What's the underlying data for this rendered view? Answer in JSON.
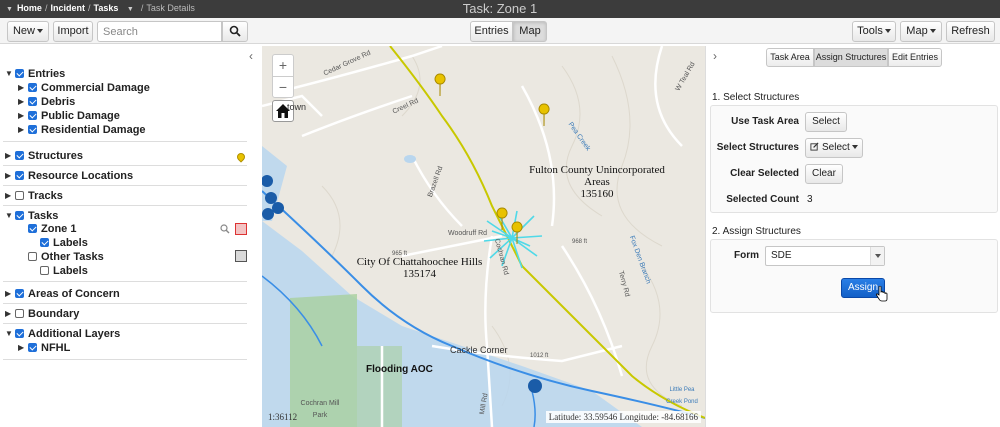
{
  "titlebar": {
    "breadcrumb": [
      "Home",
      "Incident",
      "Tasks"
    ],
    "current": "Task Details",
    "window_title": "Task: Zone 1"
  },
  "toolbar": {
    "new_label": "New",
    "import_label": "Import",
    "search_placeholder": "Search",
    "view_tabs": [
      "Entries",
      "Map"
    ],
    "active_view": "Map",
    "tools_label": "Tools",
    "map_label": "Map",
    "refresh_label": "Refresh"
  },
  "layers": {
    "entries": {
      "label": "Entries",
      "children": [
        "Commercial Damage",
        "Debris",
        "Public Damage",
        "Residential Damage"
      ]
    },
    "structures": "Structures",
    "resource_locations": "Resource Locations",
    "tracks": "Tracks",
    "tasks": {
      "label": "Tasks",
      "zone": "Zone 1",
      "zone_sub": "Labels",
      "other": "Other Tasks",
      "other_sub": "Labels"
    },
    "areas_of_concern": "Areas of Concern",
    "boundary": "Boundary",
    "additional_layers": {
      "label": "Additional Layers",
      "child": "NFHL"
    },
    "colors": {
      "zone_swatch": "#f3c4c4",
      "other_swatch": "#d9d9d9",
      "structure_pin": "#e8c200"
    }
  },
  "map": {
    "labels": {
      "fulton": "Fulton County Unincorporated Areas",
      "fulton_code": "135160",
      "chatt": "City Of Chattahoochee Hills",
      "chatt_code": "135174",
      "flooding": "Flooding AOC",
      "cackle": "Cackle Corner",
      "cochran": "Cochran Mill Park",
      "woodruff": "Woodruff Rd",
      "creel": "Creel Rd",
      "cedar": "Cedar Grove Rd",
      "pea": "Pea Creek",
      "town": "town",
      "elev1": "965 ft",
      "elev2": "968 ft",
      "elev3": "1012 ft",
      "mill": "Mill Rd",
      "terry": "Terry Rd",
      "fox": "Fox Den Branch",
      "pond": "Little Pea Creek Pond",
      "teal": "W Teal Rd",
      "brazil": "Brazell Rd",
      "cochran_rd": "Cochran Rd"
    },
    "scale": "1:36112",
    "coords": "Latitude: 33.59546 Longitude:  -84.68166",
    "colors": {
      "boundary": "#c8c800",
      "river": "#3a8ee6",
      "floodzone": "#b9d6ee",
      "park": "#a8cf9e",
      "burst": "#4fd9e8"
    }
  },
  "right": {
    "tabs": [
      "Task Area",
      "Assign Structures",
      "Edit Entries"
    ],
    "active_tab": "Assign Structures",
    "section1": "1. Select Structures",
    "use_task_area_label": "Use Task Area",
    "use_task_area_btn": "Select",
    "select_structures_label": "Select Structures",
    "select_structures_btn": "Select",
    "clear_selected_label": "Clear Selected",
    "clear_btn": "Clear",
    "selected_count_label": "Selected Count",
    "selected_count": "3",
    "section2": "2. Assign Structures",
    "form_label": "Form",
    "form_value": "SDE",
    "assign_btn": "Assign"
  }
}
